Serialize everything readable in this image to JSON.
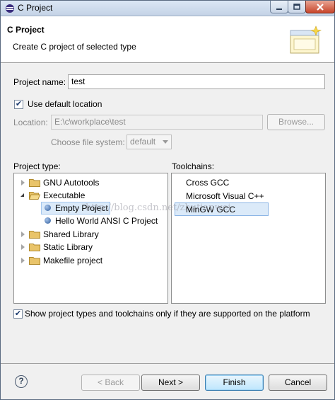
{
  "window": {
    "title": "C Project"
  },
  "header": {
    "title": "C Project",
    "description": "Create C project of selected type"
  },
  "form": {
    "project_name_label": "Project name:",
    "project_name_value": "test",
    "use_default_location_label": "Use default location",
    "use_default_location_checked": true,
    "location_label": "Location:",
    "location_value": "E:\\c\\workplace\\test",
    "browse_label": "Browse...",
    "filesystem_label": "Choose file system:",
    "filesystem_value": "default"
  },
  "project_types": {
    "label": "Project type:",
    "items": [
      {
        "label": "GNU Autotools",
        "state": "collapsed",
        "icon": "folder-icon"
      },
      {
        "label": "Executable",
        "state": "expanded",
        "icon": "folder-icon"
      },
      {
        "label": "Empty Project",
        "state": "leaf",
        "icon": "bullet-icon",
        "selected": true
      },
      {
        "label": "Hello World ANSI C Project",
        "state": "leaf",
        "icon": "bullet-icon"
      },
      {
        "label": "Shared Library",
        "state": "collapsed",
        "icon": "folder-icon"
      },
      {
        "label": "Static Library",
        "state": "collapsed",
        "icon": "folder-icon"
      },
      {
        "label": "Makefile project",
        "state": "collapsed",
        "icon": "folder-icon"
      }
    ]
  },
  "toolchains": {
    "label": "Toolchains:",
    "items": [
      {
        "label": "Cross GCC"
      },
      {
        "label": "Microsoft Visual C++"
      },
      {
        "label": "MinGW GCC",
        "selected": true
      }
    ]
  },
  "show_supported_label": "Show project types and toolchains only if they are supported on the platform",
  "show_supported_checked": true,
  "watermark": "http://blog.csdn.net/zhutianwei",
  "buttons": {
    "help": "?",
    "back": "< Back",
    "next": "Next >",
    "finish": "Finish",
    "cancel": "Cancel"
  },
  "colors": {
    "selection": "#dbeaf9",
    "close_button": "#c8462b"
  }
}
